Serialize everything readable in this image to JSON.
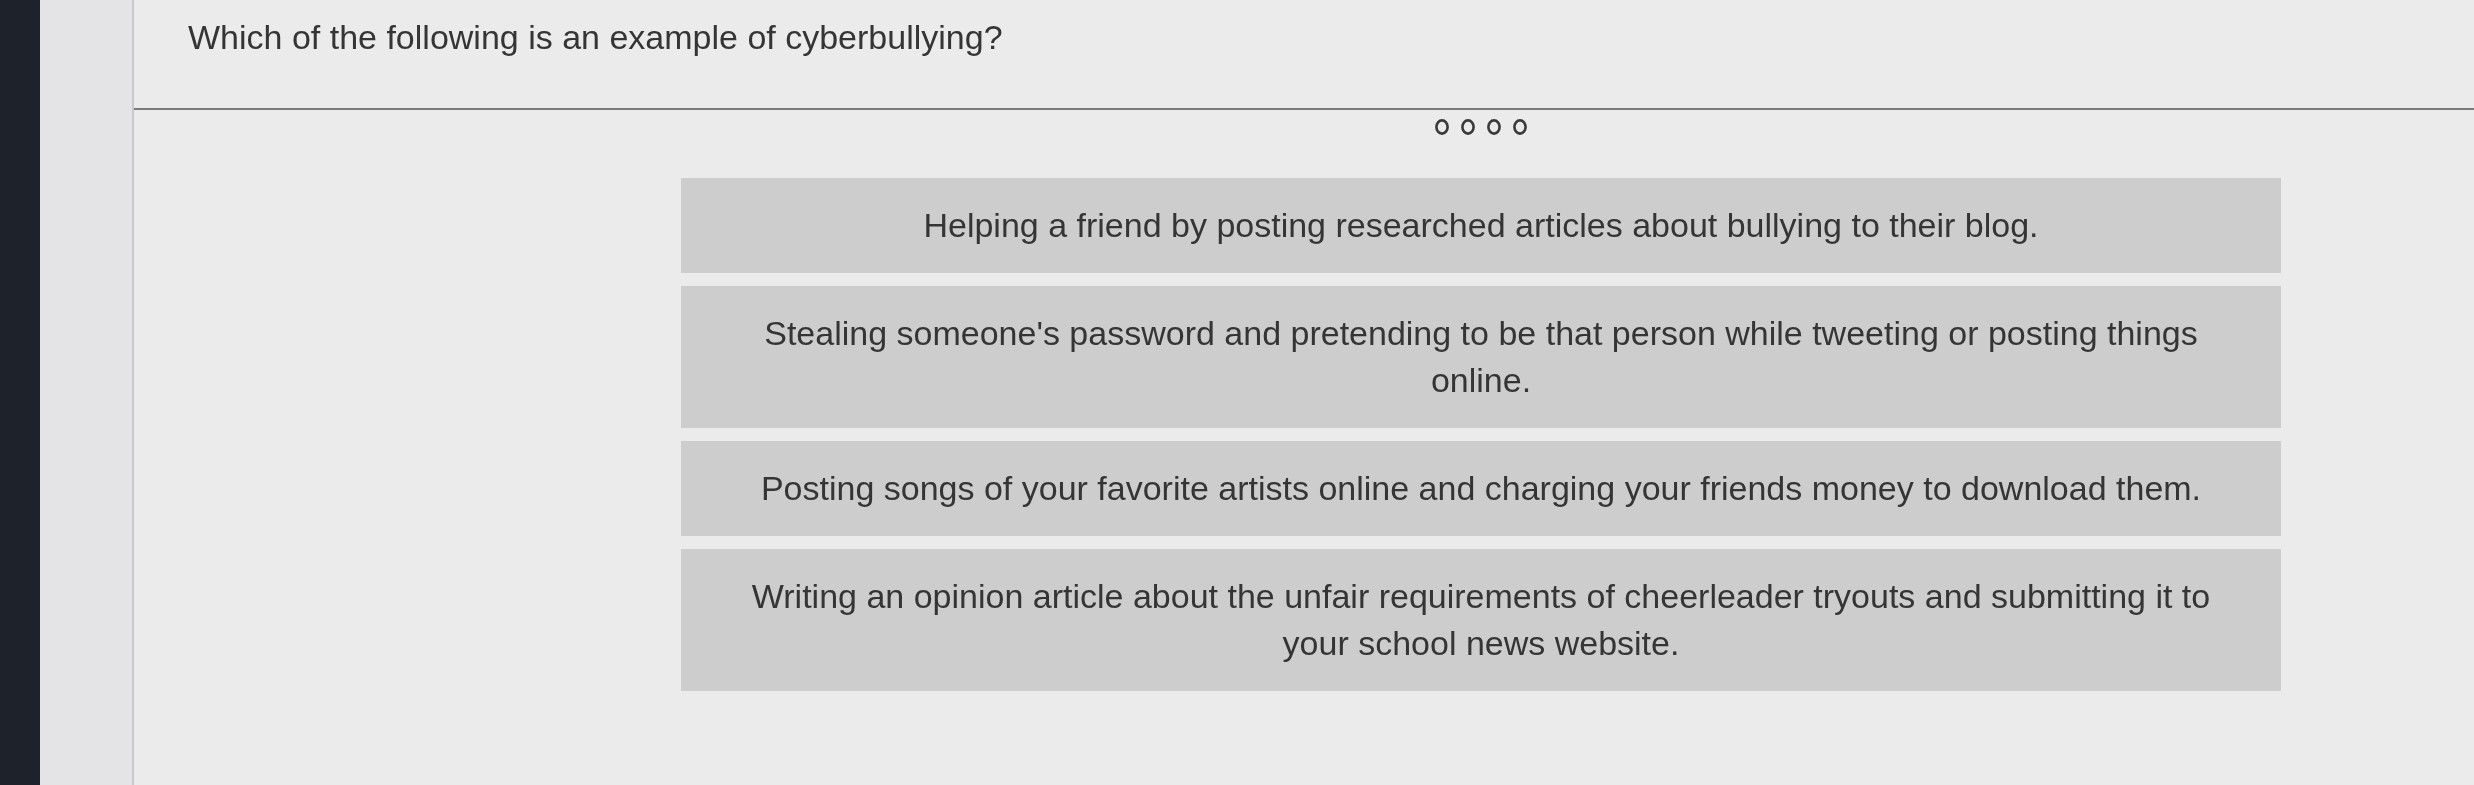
{
  "question": {
    "text": "Which of the following is an example of cyberbullying?"
  },
  "options": [
    {
      "text": "Helping a friend by posting researched articles about bullying to their blog."
    },
    {
      "text": "Stealing someone's password and pretending to be that person while tweeting or posting things online."
    },
    {
      "text": "Posting songs of your favorite artists online and charging your friends money to download them."
    },
    {
      "text": "Writing an opinion article about the unfair requirements of cheerleader tryouts and submitting it to your school news website."
    }
  ]
}
